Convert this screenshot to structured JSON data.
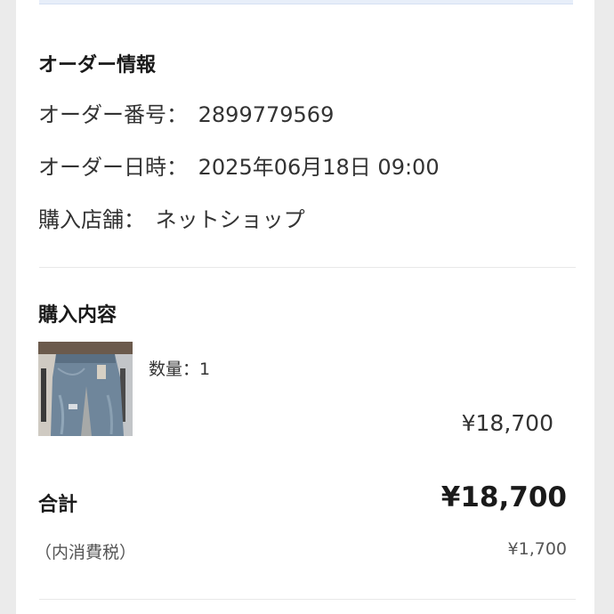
{
  "order_info": {
    "title": "オーダー情報",
    "order_number_label": "オーダー番号：",
    "order_number": "2899779569",
    "order_datetime_label": "オーダー日時：",
    "order_datetime": "2025年06月18日 09:00",
    "store_label": "購入店舗：",
    "store": "ネットショップ"
  },
  "purchase": {
    "title": "購入内容",
    "items": [
      {
        "image_icon": "jeans-product-photo",
        "quantity_text": "数量：1",
        "price": "¥18,700"
      }
    ]
  },
  "summary": {
    "total_label": "合計",
    "total_value": "¥18,700",
    "tax_label": "（内消費税）",
    "tax_value": "¥1,700"
  },
  "colors": {
    "background": "#ebebeb",
    "card": "#ffffff",
    "banner": "#e7eef9",
    "text": "#222222"
  }
}
